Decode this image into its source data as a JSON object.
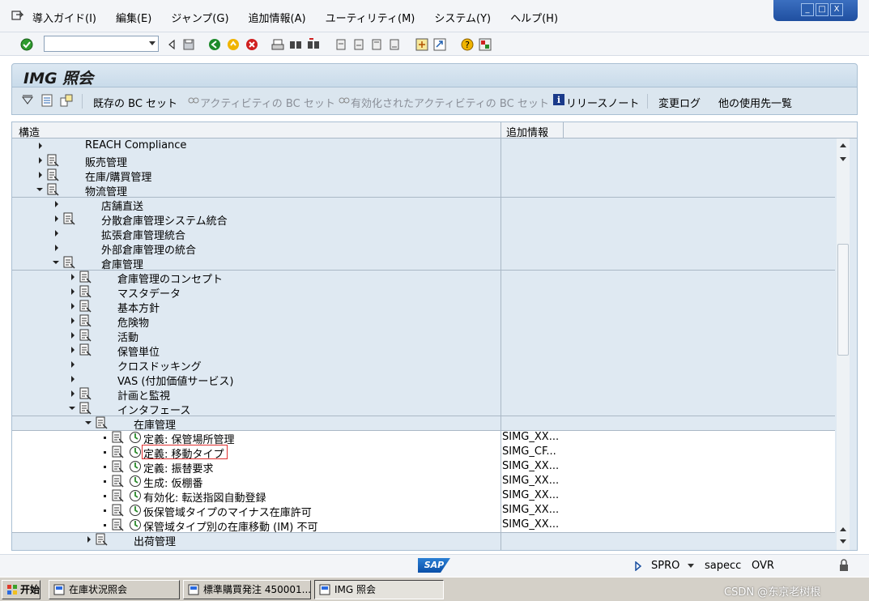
{
  "menu": {
    "items": [
      "導入ガイド(I)",
      "編集(E)",
      "ジャンプ(G)",
      "追加情報(A)",
      "ユーティリティ(M)",
      "システム(Y)",
      "ヘルプ(H)"
    ]
  },
  "window_controls": [
    "_",
    "□",
    "X"
  ],
  "title": "IMG 照会",
  "app_toolbar": {
    "existing_bc_set": "既存の BC セット",
    "activity_bc_set": "アクティビティの BC セット",
    "activated_activity_bc_set": "有効化されたアクティビティの BC セット",
    "release_notes": "リリースノート",
    "change_log": "変更ログ",
    "other_usage": "他の使用先一覧"
  },
  "tree": {
    "col_structure": "構造",
    "col_info": "追加情報",
    "rows": [
      {
        "label": "REACH Compliance",
        "level": 1,
        "info": ""
      },
      {
        "label": "販売管理",
        "level": 1,
        "info": ""
      },
      {
        "label": "在庫/購買管理",
        "level": 1,
        "info": ""
      },
      {
        "label": "物流管理",
        "level": 1,
        "info": ""
      },
      {
        "label": "店舗直送",
        "level": 2,
        "info": ""
      },
      {
        "label": "分散倉庫管理システム統合",
        "level": 2,
        "info": ""
      },
      {
        "label": "拡張倉庫管理統合",
        "level": 2,
        "info": ""
      },
      {
        "label": "外部倉庫管理の統合",
        "level": 2,
        "info": ""
      },
      {
        "label": "倉庫管理",
        "level": 2,
        "info": ""
      },
      {
        "label": "倉庫管理のコンセプト",
        "level": 3,
        "info": ""
      },
      {
        "label": "マスタデータ",
        "level": 3,
        "info": ""
      },
      {
        "label": "基本方針",
        "level": 3,
        "info": ""
      },
      {
        "label": "危険物",
        "level": 3,
        "info": ""
      },
      {
        "label": "活動",
        "level": 3,
        "info": ""
      },
      {
        "label": "保管単位",
        "level": 3,
        "info": ""
      },
      {
        "label": "クロスドッキング",
        "level": 3,
        "info": ""
      },
      {
        "label": "VAS (付加価値サービス)",
        "level": 3,
        "info": ""
      },
      {
        "label": "計画と監視",
        "level": 3,
        "info": ""
      },
      {
        "label": "インタフェース",
        "level": 3,
        "info": ""
      },
      {
        "label": "在庫管理",
        "level": 4,
        "info": ""
      },
      {
        "label": "定義: 保管場所管理",
        "level": 5,
        "info": "SIMG_XX..."
      },
      {
        "label": "定義: 移動タイプ",
        "level": 5,
        "info": "SIMG_CF..."
      },
      {
        "label": "定義: 振替要求",
        "level": 5,
        "info": "SIMG_XX..."
      },
      {
        "label": "生成: 仮棚番",
        "level": 5,
        "info": "SIMG_XX..."
      },
      {
        "label": "有効化: 転送指図自動登録",
        "level": 5,
        "info": "SIMG_XX..."
      },
      {
        "label": "仮保管域タイプのマイナス在庫許可",
        "level": 5,
        "info": "SIMG_XX..."
      },
      {
        "label": "保管域タイプ別の在庫移動 (IM) 不可",
        "level": 5,
        "info": "SIMG_XX..."
      },
      {
        "label": "出荷管理",
        "level": 4,
        "info": ""
      }
    ]
  },
  "status": {
    "logo": "SAP",
    "tcode": "SPRO",
    "server": "sapecc",
    "mode": "OVR"
  },
  "taskbar": {
    "start": "开始",
    "items": [
      "在庫状況照会",
      "標準購買発注 450001...",
      "IMG 照会"
    ],
    "tray_text": "CSDN @东京老树根"
  },
  "colors": {
    "tree_bg": "#dfe9f2",
    "highlight_border": "#e03030",
    "title_bg": "#c9dbea"
  }
}
